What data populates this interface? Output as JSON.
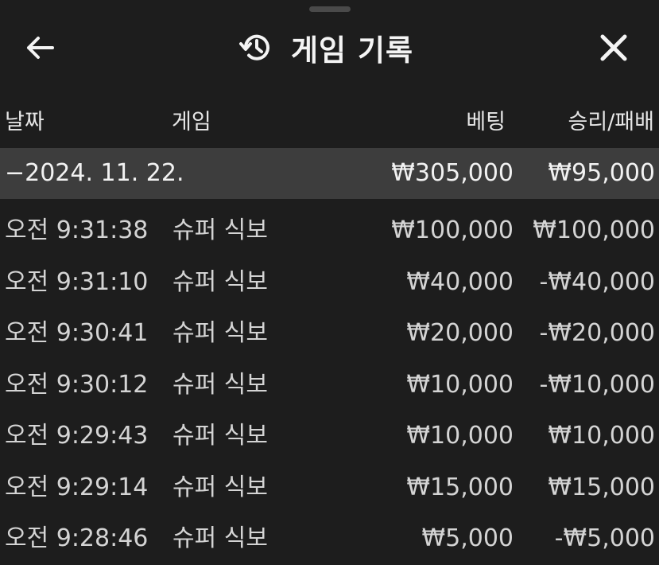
{
  "header": {
    "title": "게임 기록",
    "back_icon": "arrow-left-icon",
    "history_icon": "history-icon",
    "close_icon": "close-icon"
  },
  "columns": {
    "date": "날짜",
    "game": "게임",
    "bet": "베팅",
    "result": "승리/패배"
  },
  "group": {
    "date": "−2024. 11. 22.",
    "total_bet": "₩305,000",
    "total_result": "₩95,000"
  },
  "rows": [
    {
      "time": "오전 9:31:38",
      "game": "슈퍼 식보",
      "bet": "₩100,000",
      "result": "₩100,000"
    },
    {
      "time": "오전 9:31:10",
      "game": "슈퍼 식보",
      "bet": "₩40,000",
      "result": "-₩40,000"
    },
    {
      "time": "오전 9:30:41",
      "game": "슈퍼 식보",
      "bet": "₩20,000",
      "result": "-₩20,000"
    },
    {
      "time": "오전 9:30:12",
      "game": "슈퍼 식보",
      "bet": "₩10,000",
      "result": "-₩10,000"
    },
    {
      "time": "오전 9:29:43",
      "game": "슈퍼 식보",
      "bet": "₩10,000",
      "result": "₩10,000"
    },
    {
      "time": "오전 9:29:14",
      "game": "슈퍼 식보",
      "bet": "₩15,000",
      "result": "₩15,000"
    },
    {
      "time": "오전 9:28:46",
      "game": "슈퍼 식보",
      "bet": "₩5,000",
      "result": "-₩5,000"
    }
  ],
  "colors": {
    "background": "#1d1d1d",
    "group_row": "#3d3d3d",
    "text": "#ececec"
  }
}
